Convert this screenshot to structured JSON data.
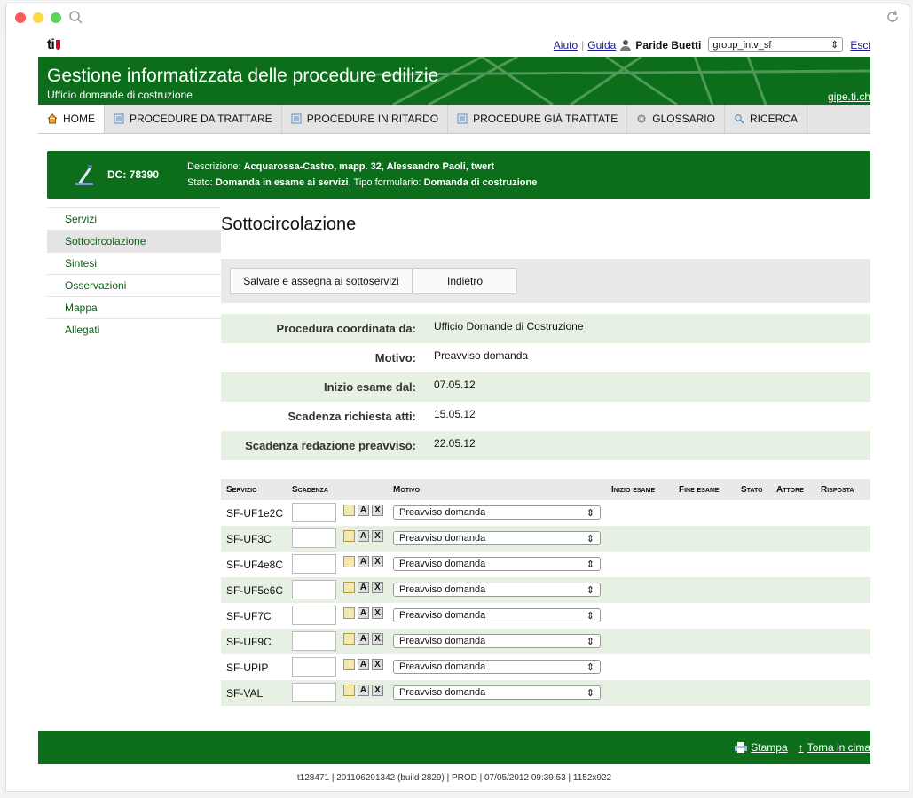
{
  "util": {
    "logo": "ti",
    "help": "Aiuto",
    "guide": "Guida",
    "user": "Paride Buetti",
    "group": "group_intv_sf",
    "logout": "Esci"
  },
  "header": {
    "title": "Gestione informatizzata delle procedure edilizie",
    "subtitle": "Ufficio domande di costruzione",
    "site": "gipe.ti.ch"
  },
  "nav": [
    {
      "label": "HOME",
      "icon": "home-icon"
    },
    {
      "label": "PROCEDURE DA TRATTARE",
      "icon": "list-icon"
    },
    {
      "label": "PROCEDURE IN RITARDO",
      "icon": "list-icon"
    },
    {
      "label": "PROCEDURE GIÀ TRATTATE",
      "icon": "list-icon"
    },
    {
      "label": "GLOSSARIO",
      "icon": "gear-icon"
    },
    {
      "label": "RICERCA",
      "icon": "search-icon"
    }
  ],
  "banner": {
    "dc": "DC: 78390",
    "desc_label": "Descrizione:",
    "desc_value": "Acquarossa-Castro, mapp. 32, Alessandro Paoli, twert",
    "state_label": "Stato:",
    "state_value": "Domanda in esame ai servizi",
    "form_label": ", Tipo formulario:",
    "form_value": "Domanda di costruzione"
  },
  "sidebar": [
    {
      "label": "Servizi"
    },
    {
      "label": "Sottocircolazione"
    },
    {
      "label": "Sintesi"
    },
    {
      "label": "Osservazioni"
    },
    {
      "label": "Mappa"
    },
    {
      "label": "Allegati"
    }
  ],
  "main": {
    "title": "Sottocircolazione",
    "save_button": "Salvare e assegna ai sottoservizi",
    "back_button": "Indietro"
  },
  "info": [
    {
      "label": "Procedura coordinata da:",
      "value": "Ufficio Domande di Costruzione"
    },
    {
      "label": "Motivo:",
      "value": "Preavviso domanda"
    },
    {
      "label": "Inizio esame dal:",
      "value": "07.05.12"
    },
    {
      "label": "Scadenza richiesta atti:",
      "value": "15.05.12"
    },
    {
      "label": "Scadenza redazione preavviso:",
      "value": "22.05.12"
    }
  ],
  "services_head": {
    "servizio": "Servizio",
    "scadenza": "Scadenza",
    "motivo": "Motivo",
    "inizio": "Inizio esame",
    "fine": "Fine esame",
    "stato": "Stato",
    "attore": "Attore",
    "risposta": "Risposta"
  },
  "services": [
    {
      "name": "SF-UF1e2C",
      "motivo": "Preavviso domanda"
    },
    {
      "name": "SF-UF3C",
      "motivo": "Preavviso domanda"
    },
    {
      "name": "SF-UF4e8C",
      "motivo": "Preavviso domanda"
    },
    {
      "name": "SF-UF5e6C",
      "motivo": "Preavviso domanda"
    },
    {
      "name": "SF-UF7C",
      "motivo": "Preavviso domanda"
    },
    {
      "name": "SF-UF9C",
      "motivo": "Preavviso domanda"
    },
    {
      "name": "SF-UPIP",
      "motivo": "Preavviso domanda"
    },
    {
      "name": "SF-VAL",
      "motivo": "Preavviso domanda"
    }
  ],
  "footer": {
    "print": "Stampa",
    "top": "Torna in cima",
    "meta": "t128471 | 201106291342 (build 2829) | PROD | 07/05/2012 09:39:53 | 1152x922"
  },
  "mini_labels": {
    "a": "A",
    "x": "X"
  },
  "colors": {
    "brand_green": "#0c6d1a",
    "row_alt": "#e6f0e3",
    "accent_red": "#c8102e"
  }
}
